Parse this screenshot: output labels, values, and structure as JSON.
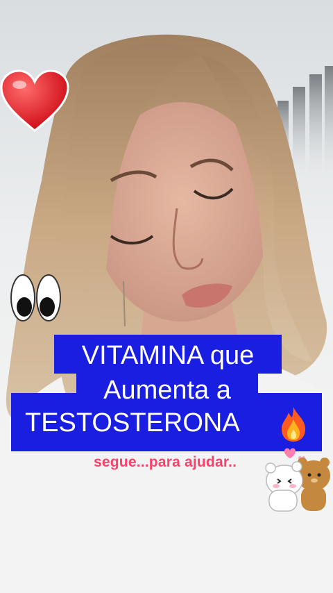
{
  "caption": {
    "line1": "VITAMINA que",
    "line2": "Aumenta a",
    "line3": "TESTOSTERONA",
    "emoji": "fire-icon",
    "background": "#1a1ee0",
    "text_color": "#ffffff"
  },
  "subtitle": {
    "text": "segue...para ajudar..",
    "color": "#ff3f6a"
  },
  "stickers": [
    "heart-icon",
    "eyes-icon",
    "hugging-bears-icon"
  ]
}
